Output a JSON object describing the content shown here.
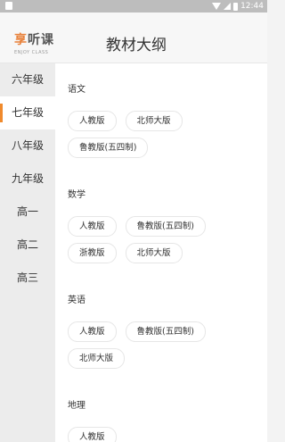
{
  "statusbar": {
    "time": "12:44"
  },
  "header": {
    "logo_main_orange": "享",
    "logo_main_dark": "听课",
    "logo_sub": "ENJOY CLASS",
    "title": "教材大纲"
  },
  "sidebar": {
    "items": [
      {
        "label": "六年级"
      },
      {
        "label": "七年级"
      },
      {
        "label": "八年级"
      },
      {
        "label": "九年级"
      },
      {
        "label": "高一"
      },
      {
        "label": "高二"
      },
      {
        "label": "高三"
      }
    ],
    "selected": "七年级"
  },
  "subjects": [
    {
      "title": "语文",
      "editions": [
        "人教版",
        "北师大版",
        "鲁教版(五四制)"
      ]
    },
    {
      "title": "数学",
      "editions": [
        "人教版",
        "鲁教版(五四制)",
        "浙教版",
        "北师大版"
      ]
    },
    {
      "title": "英语",
      "editions": [
        "人教版",
        "鲁教版(五四制)",
        "北师大版"
      ]
    },
    {
      "title": "地理",
      "editions": [
        "人教版"
      ]
    }
  ],
  "colors": {
    "accent": "#f08a2c",
    "logo_orange": "#e8813a"
  }
}
